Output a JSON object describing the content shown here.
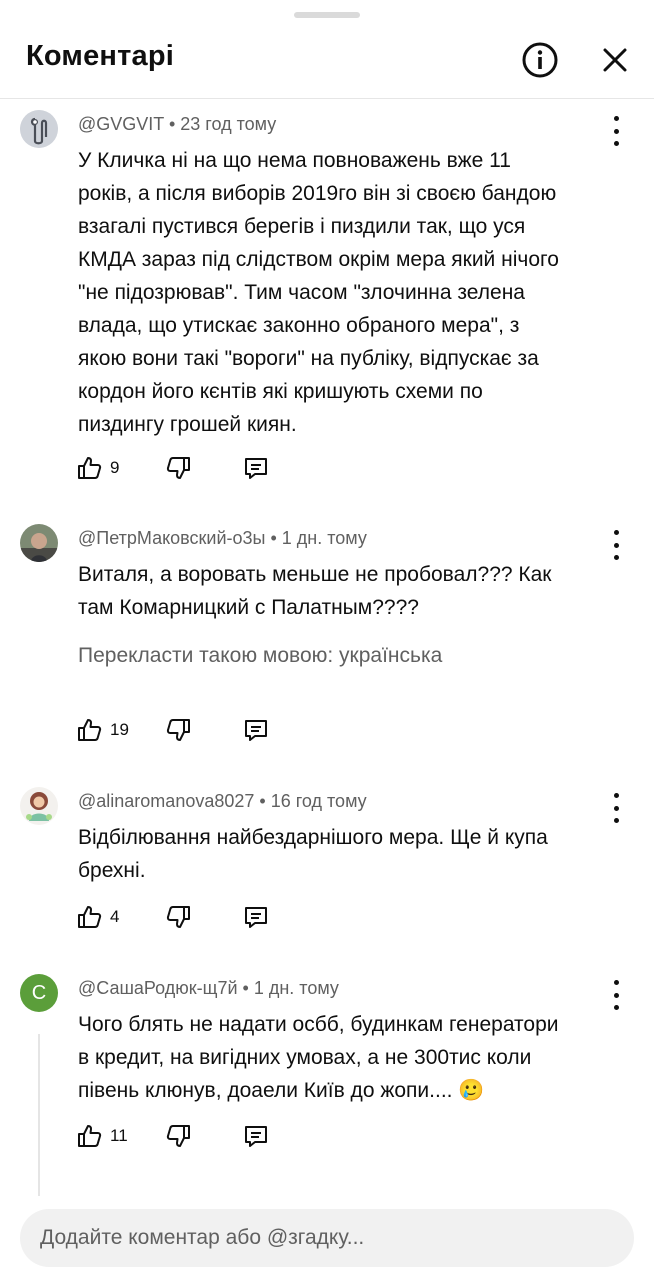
{
  "header": {
    "title": "Коментарі"
  },
  "comments": [
    {
      "author": "@GVGVIT",
      "time": "23 год тому",
      "lines": [
        "У Кличка ні на що нема повноважень вже 11",
        "років, а після виборів 2019го він зі своєю бандою",
        "взагалі пустився берегів і пиздили так, що уся",
        "КМДА зараз під слідством окрім мера який нічого",
        "\"не підозрював\". Тим часом \"злочинна зелена",
        "влада, що утискає законно обраного мера\", з",
        "якою вони такі \"вороги\" на публіку, відпускає за",
        "кордон його кєнтів які кришують схеми по",
        "пиздингу грошей киян."
      ],
      "likes": "9"
    },
    {
      "author": "@ПетрМаковский-о3ы",
      "time": "1 дн. тому",
      "lines": [
        "Виталя, а воровать меньше не пробовал??? Как",
        "там Комарницкий с Палатным????"
      ],
      "translate": "Перекласти такою мовою: українська",
      "likes": "19"
    },
    {
      "author": "@alinaromanova8027",
      "time": "16 год тому",
      "lines": [
        "Відбілювання найбездарнішого мера. Ще й купа",
        "брехні."
      ],
      "likes": "4"
    },
    {
      "author": "@СашаРодюк-щ7й",
      "avatar_letter": "С",
      "time": "1 дн. тому",
      "lines": [
        "Чого блять не надати осбб, будинкам генератори",
        "в кредит, на вигідних умовах, а не 300тис коли",
        "півень клюнув, доаели Київ до жопи.... 🥲"
      ],
      "likes": "11"
    }
  ],
  "input": {
    "placeholder": "Додайте коментар або @згадку..."
  },
  "colors": {
    "avatar_green": "#5b9e3a",
    "secondary_text": "#606060"
  }
}
